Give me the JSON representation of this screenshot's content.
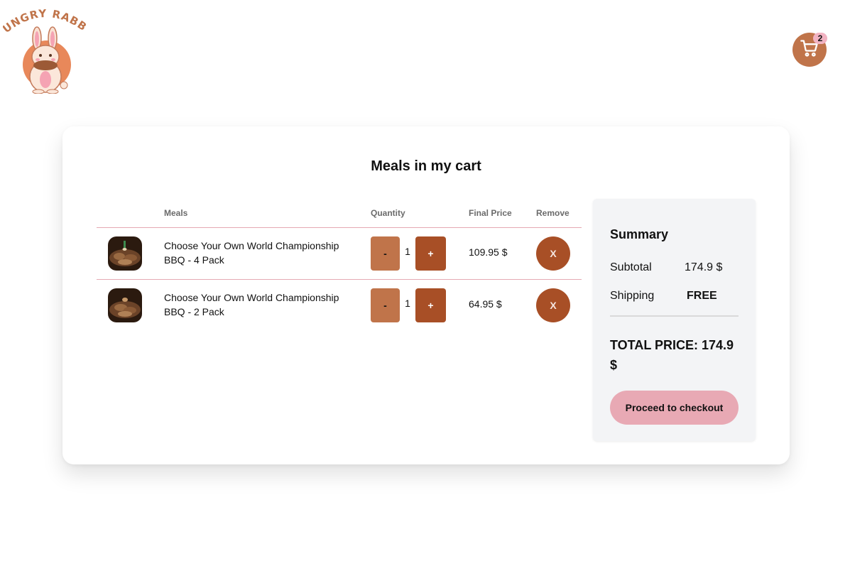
{
  "brand": {
    "logo_text": "HUNGRY RABBIT"
  },
  "header": {
    "cart_icon": "cart-icon",
    "cart_count": "2"
  },
  "cart": {
    "title": "Meals in my cart",
    "columns": {
      "meals": "Meals",
      "quantity": "Quantity",
      "final_price": "Final Price",
      "remove": "Remove"
    },
    "items": [
      {
        "name": "Choose Your Own World Championship BBQ - 4 Pack",
        "minus_label": "-",
        "quantity": "1",
        "plus_label": "+",
        "final_price": "109.95 $",
        "remove_label": "X"
      },
      {
        "name": "Choose Your Own World Championship BBQ - 2 Pack",
        "minus_label": "-",
        "quantity": "1",
        "plus_label": "+",
        "final_price": "64.95 $",
        "remove_label": "X"
      }
    ]
  },
  "summary": {
    "title": "Summary",
    "subtotal_label": "Subtotal",
    "subtotal_value": "174.9 $",
    "shipping_label": "Shipping",
    "shipping_value": "FREE",
    "total_text": "TOTAL PRICE: 174.9 $",
    "checkout_label": "Proceed to checkout"
  },
  "colors": {
    "accent_light": "#c0744a",
    "accent_dark": "#a84f26",
    "pink": "#e8a9b4",
    "divider": "#e5a9b3"
  }
}
